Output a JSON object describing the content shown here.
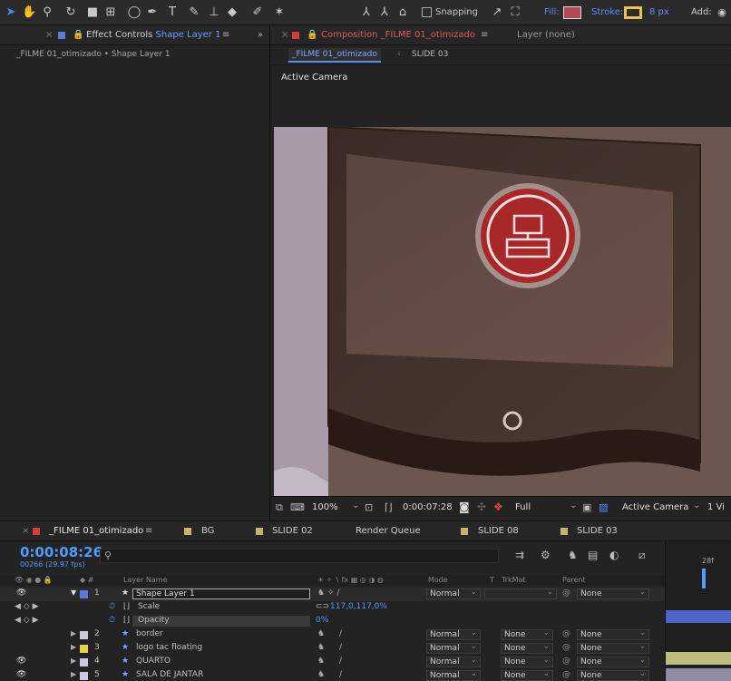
{
  "toolbar": {
    "snapping_label": "Snapping",
    "fill_label": "Fill:",
    "stroke_label": "Stroke:",
    "stroke_width": "8 px",
    "add_label": "Add:",
    "fill_color": "#b04a55",
    "stroke_color": "#e8c64a"
  },
  "left_panel": {
    "tab_label": "Effect Controls",
    "tab_layer": "Shape Layer 1",
    "breadcrumb": "_FILME 01_otimizado • Shape Layer 1"
  },
  "comp_panel": {
    "tab_label": "Composition",
    "tab_comp": "_FILME 01_otimizado",
    "layer_tab": "Layer (none)",
    "flow_current": "_FILME 01_otimizado",
    "flow_next": "SLIDE 03",
    "camera_label": "Active Camera"
  },
  "viewer_bar": {
    "zoom": "100%",
    "timecode": "0:00:07:28",
    "resolution": "Full",
    "camera": "Active Camera",
    "views": "1 Vi"
  },
  "timeline": {
    "tabs": [
      "_FILME 01_otimizado",
      "BG",
      "SLIDE 02",
      "Render Queue",
      "SLIDE 08",
      "SLIDE 03"
    ],
    "tab_colors": [
      "#d63a3a",
      "#c9b36b",
      "#c9b36b",
      "",
      "#c9b36b",
      "#c9b36b"
    ],
    "current_time": "0:00:08:26",
    "frames_info": "00266 (29.97 fps)",
    "search_icon": "search-icon",
    "headers": {
      "layer_name": "Layer Name",
      "mode": "Mode",
      "t": "T",
      "trkmat": "TrkMat",
      "parent": "Parent"
    },
    "ruler_label": "28f",
    "layers": [
      {
        "num": "1",
        "name": "Shape Layer 1",
        "color": "#5b7bd8",
        "mode": "Normal",
        "trkmat": "",
        "parent": "None",
        "selected": true,
        "star": true
      },
      {
        "num": "2",
        "name": "border",
        "color": "#c9c9e6",
        "mode": "Normal",
        "trkmat": "None",
        "parent": "None"
      },
      {
        "num": "3",
        "name": "logo tac floating",
        "color": "#e5d04a",
        "mode": "Normal",
        "trkmat": "None",
        "parent": "None"
      },
      {
        "num": "4",
        "name": "QUARTO",
        "color": "#c9c9e6",
        "mode": "Normal",
        "trkmat": "None",
        "parent": "None"
      },
      {
        "num": "5",
        "name": "SALA DE JANTAR",
        "color": "#c9c9e6",
        "mode": "Normal",
        "trkmat": "None",
        "parent": "None"
      }
    ],
    "properties": [
      {
        "name": "Scale",
        "value": "117,0,117,0%"
      },
      {
        "name": "Opacity",
        "value": "0%"
      }
    ]
  },
  "colors": {
    "accent": "#3a8bff",
    "timecode": "#4f9cff",
    "badge_red": "#a8282a"
  }
}
